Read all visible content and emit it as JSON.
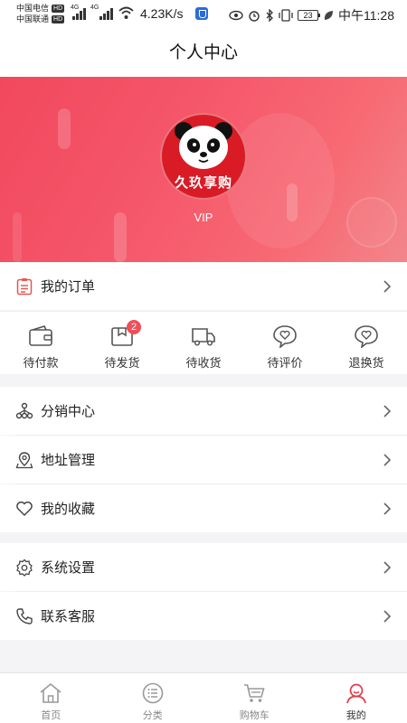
{
  "status_bar": {
    "carrier1": "中国电信",
    "carrier2": "中国联通",
    "hd": "HD",
    "net1": "4G",
    "net2": "4G",
    "speed": "4.23K/s",
    "battery": "23",
    "time": "中午11:28"
  },
  "page": {
    "title": "个人中心"
  },
  "profile": {
    "brand": "久玖享购",
    "level": "VIP"
  },
  "orders": {
    "label": "我的订单",
    "items": [
      {
        "label": "待付款",
        "icon": "wallet-icon"
      },
      {
        "label": "待发货",
        "icon": "package-icon",
        "badge": "2"
      },
      {
        "label": "待收货",
        "icon": "truck-icon"
      },
      {
        "label": "待评价",
        "icon": "heart-chat-icon"
      },
      {
        "label": "退换货",
        "icon": "heart-chat-icon"
      }
    ]
  },
  "menu": {
    "distribution": "分销中心",
    "address": "地址管理",
    "favorites": "我的收藏",
    "settings": "系统设置",
    "service": "联系客服"
  },
  "tabbar": {
    "active_color": "#e33b45",
    "items": [
      {
        "label": "首页",
        "icon": "home-icon"
      },
      {
        "label": "分类",
        "icon": "list-icon"
      },
      {
        "label": "购物车",
        "icon": "cart-icon"
      },
      {
        "label": "我的",
        "icon": "user-icon"
      }
    ]
  },
  "colors": {
    "hero": "#f1485d",
    "accent": "#ef4f56"
  }
}
